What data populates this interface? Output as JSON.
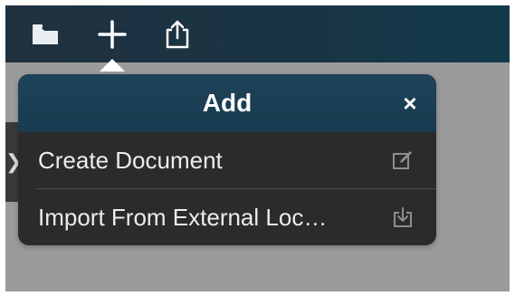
{
  "toolbar": {
    "buttons": [
      {
        "name": "folder",
        "icon": "folder-icon"
      },
      {
        "name": "add",
        "icon": "plus-icon"
      },
      {
        "name": "share",
        "icon": "share-icon"
      }
    ]
  },
  "popover": {
    "title": "Add",
    "close_label": "×",
    "items": [
      {
        "label": "Create Document",
        "icon": "edit-icon"
      },
      {
        "label": "Import From External Loc…",
        "icon": "import-icon"
      }
    ]
  },
  "side_tab": {
    "glyph": "❯"
  },
  "colors": {
    "toolbar_bg": "#1a3444",
    "popover_header": "#1e4258",
    "popover_body": "#2b2b2b",
    "backdrop": "#9b9b9b"
  }
}
